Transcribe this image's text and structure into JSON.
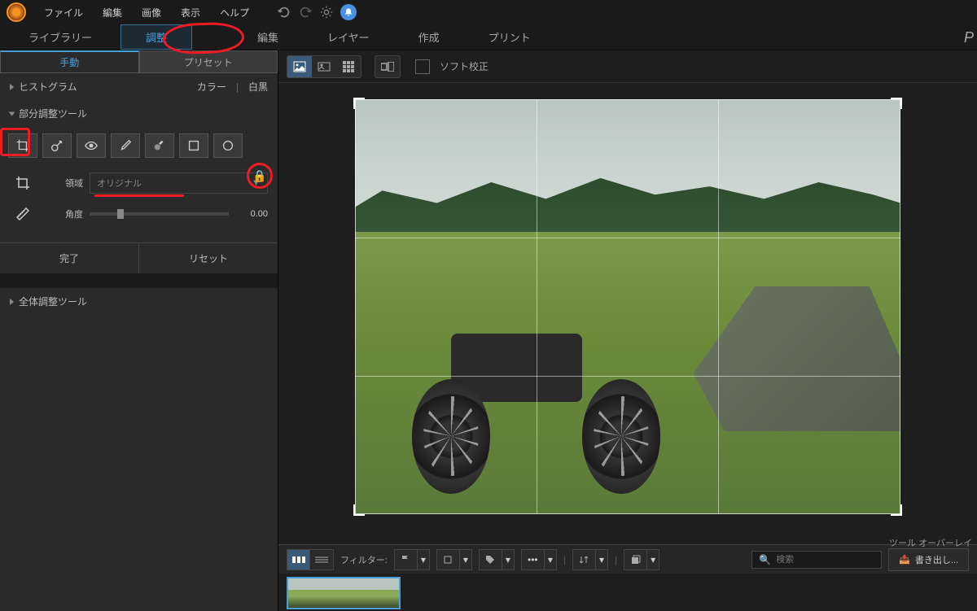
{
  "menu": {
    "file": "ファイル",
    "edit": "編集",
    "image": "画像",
    "view": "表示",
    "help": "ヘルプ"
  },
  "mainTabs": {
    "library": "ライブラリー",
    "adjust": "調整",
    "edit": "編集",
    "layer": "レイヤー",
    "create": "作成",
    "print": "プリント"
  },
  "subTabs": {
    "manual": "手動",
    "preset": "プリセット"
  },
  "histogram": {
    "title": "ヒストグラム",
    "color": "カラー",
    "bw": "白黒"
  },
  "localTools": {
    "title": "部分調整ツール"
  },
  "crop": {
    "areaLabel": "領域",
    "areaValue": "オリジナル",
    "angleLabel": "角度",
    "angleValue": "0.00"
  },
  "actions": {
    "done": "完了",
    "reset": "リセット"
  },
  "globalTools": {
    "title": "全体調整ツール"
  },
  "softProof": "ソフト校正",
  "overlayLabel": "ツール オーバーレイ",
  "filterLabel": "フィルター:",
  "searchPlaceholder": "検索",
  "exportLabel": "書き出し...",
  "pLabel": "P"
}
